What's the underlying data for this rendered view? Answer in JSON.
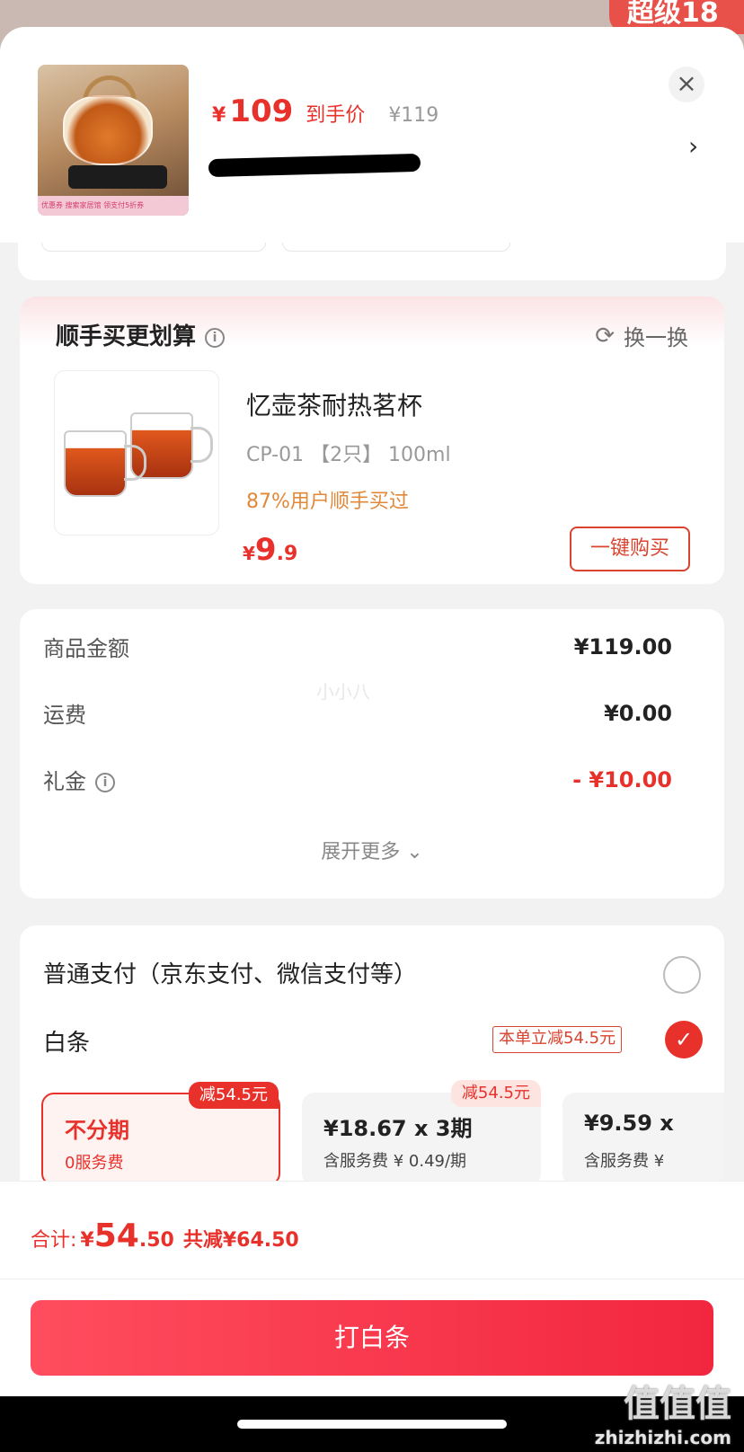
{
  "backdrop": {
    "badge": "超级18"
  },
  "product": {
    "yen": "¥",
    "price": "109",
    "price_tag": "到手价",
    "original_price": "¥119",
    "thumb_strip": "优惠券 搜索家居馆 领支付5折券",
    "close": "×",
    "chevron": "›"
  },
  "recommend": {
    "title": "顺手买更划算",
    "info": "i",
    "refresh": "换一换",
    "name": "忆壶茶耐热茗杯",
    "spec": "CP-01 【2只】 100ml",
    "stat": "87%用户顺手买过",
    "price_yen": "¥",
    "price_int": "9",
    "price_dec": ".9",
    "buy_button": "一键购买"
  },
  "summary": {
    "rows": [
      {
        "label": "商品金额",
        "value": "¥119.00"
      },
      {
        "label": "运费",
        "value": "¥0.00"
      },
      {
        "label": "礼金",
        "value": "- ¥10.00"
      }
    ],
    "watermark": "小小八",
    "expand": "展开更多 ⌄"
  },
  "payment": {
    "normal_label": "普通支付（京东支付、微信支付等）",
    "baitiao_label": "白条",
    "promo_tag": "本单立减54.5元",
    "check": "✓",
    "plans": [
      {
        "tag": "减54.5元",
        "line1": "不分期",
        "line2": "0服务费"
      },
      {
        "tag": "减54.5元",
        "line1": "¥18.67 x 3期",
        "line2": "含服务费 ¥ 0.49/期"
      },
      {
        "tag": "",
        "line1": "¥9.59 x",
        "line2": "含服务费 ¥"
      }
    ]
  },
  "footer": {
    "total_label": "合计:",
    "total_yen": "¥",
    "total_int": "54",
    "total_dec": ".50",
    "saving": "共减¥64.50",
    "button": "打白条"
  },
  "site_watermark": {
    "big": "值值值",
    "small": "zhizhizhi.com"
  },
  "colors": {
    "accent": "#e8312b",
    "button": "#f2263f",
    "recommend_stat": "#e0893a"
  }
}
